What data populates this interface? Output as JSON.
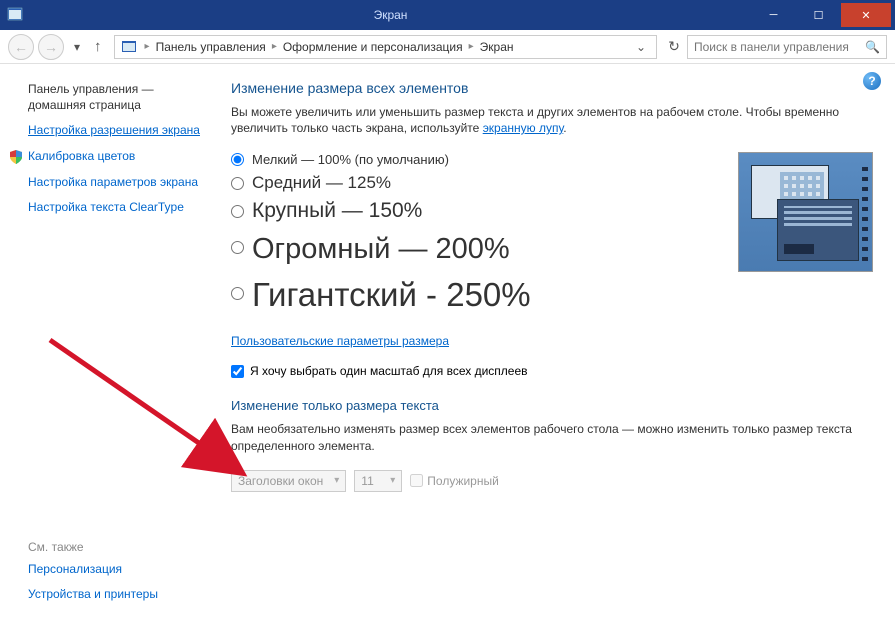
{
  "titlebar": {
    "title": "Экран"
  },
  "breadcrumb": {
    "items": [
      "Панель управления",
      "Оформление и персонализация",
      "Экран"
    ]
  },
  "search": {
    "placeholder": "Поиск в панели управления"
  },
  "sidebar": {
    "home_line1": "Панель управления —",
    "home_line2": "домашняя страница",
    "links": [
      {
        "label": "Настройка разрешения экрана",
        "active": true,
        "shield": false
      },
      {
        "label": "Калибровка цветов",
        "active": false,
        "shield": true
      },
      {
        "label": "Настройка параметров экрана",
        "active": false,
        "shield": false
      },
      {
        "label": "Настройка текста ClearType",
        "active": false,
        "shield": false
      }
    ],
    "also_heading": "См. также",
    "also": [
      "Персонализация",
      "Устройства и принтеры"
    ]
  },
  "main": {
    "h1": "Изменение размера всех элементов",
    "desc_pre": "Вы можете увеличить или уменьшить размер текста и других элементов на рабочем столе. Чтобы временно увеличить только часть экрана, используйте ",
    "desc_link": "экранную лупу",
    "desc_post": ".",
    "options": [
      "Мелкий — 100% (по умолчанию)",
      "Средний — 125%",
      "Крупный — 150%",
      "Огромный — 200%",
      "Гигантский - 250%"
    ],
    "custom_link": "Пользовательские параметры размера",
    "checkbox_label": "Я хочу выбрать один масштаб для всех дисплеев",
    "h2": "Изменение только размера текста",
    "desc2": "Вам необязательно изменять размер всех элементов рабочего стола — можно изменить только размер текста определенного элемента.",
    "select_item": "Заголовки окон",
    "select_size": "11",
    "bold_label": "Полужирный"
  }
}
